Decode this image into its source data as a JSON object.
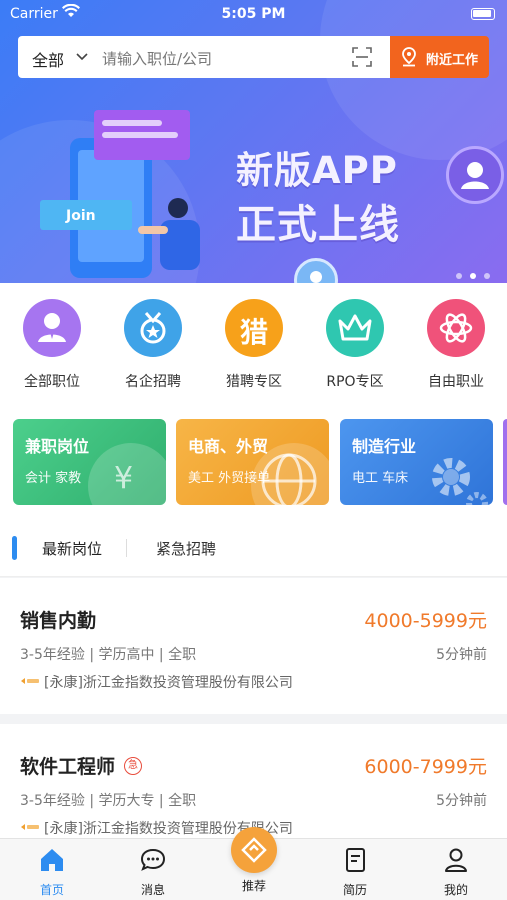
{
  "status_bar": {
    "carrier": "Carrier",
    "time": "5:05 PM"
  },
  "search": {
    "category": "全部",
    "placeholder": "请输入职位/公司",
    "nearby_label": "附近工作"
  },
  "banner": {
    "line1": "新版APP",
    "line2": "正式上线",
    "join_label": "Join",
    "page_count": 3,
    "active_index": 1
  },
  "quick_links": [
    {
      "label": "全部职位",
      "icon": "user-tie-icon",
      "color": "#a675f0"
    },
    {
      "label": "名企招聘",
      "icon": "medal-icon",
      "color": "#3fa3e8"
    },
    {
      "label": "猎聘专区",
      "icon": "猎",
      "color": "#f7a11a"
    },
    {
      "label": "RPO专区",
      "icon": "crown-icon",
      "color": "#2fc7b0"
    },
    {
      "label": "自由职业",
      "icon": "atom-icon",
      "color": "#f0527a"
    }
  ],
  "category_cards": [
    {
      "title": "兼职岗位",
      "tags": "会计   家教",
      "color": "#3cbf7e"
    },
    {
      "title": "电商、外贸",
      "tags": "美工   外贸接单",
      "color": "#f2a52f"
    },
    {
      "title": "制造行业",
      "tags": "电工   车床",
      "color": "#3a86e0"
    }
  ],
  "tabs": {
    "latest": "最新岗位",
    "urgent": "紧急招聘"
  },
  "jobs": [
    {
      "title": "销售内勤",
      "salary": "4000-5999元",
      "meta": "3-5年经验 | 学历高中 | 全职",
      "time": "5分钟前",
      "company": "[永康]浙江金指数投资管理股份有限公司",
      "urgent": false
    },
    {
      "title": "软件工程师",
      "salary": "6000-7999元",
      "meta": "3-5年经验 | 学历大专 | 全职",
      "time": "5分钟前",
      "company": "[永康]浙江金指数投资管理股份有限公司",
      "urgent": true,
      "urgent_mark": "急"
    }
  ],
  "bottom_nav": [
    {
      "label": "首页",
      "icon": "home-icon",
      "active": true
    },
    {
      "label": "消息",
      "icon": "chat-icon",
      "active": false
    },
    {
      "label": "推荐",
      "icon": "recommend-icon",
      "active": false
    },
    {
      "label": "简历",
      "icon": "resume-icon",
      "active": false
    },
    {
      "label": "我的",
      "icon": "profile-icon",
      "active": false
    }
  ],
  "colors": {
    "accent": "#2d8cf0",
    "nearby": "#f2641e",
    "salary": "#f07a2b"
  }
}
